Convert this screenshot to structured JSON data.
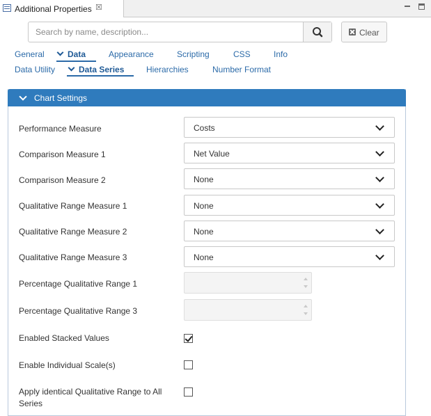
{
  "view": {
    "title": "Additional Properties",
    "close_icon": "close-icon",
    "minimize_icon": "minimize-icon",
    "maximize_icon": "maximize-icon"
  },
  "search": {
    "placeholder": "Search by name, description...",
    "value": "",
    "button_icon": "search-icon",
    "clear_label": "Clear"
  },
  "tabs_row1": [
    {
      "label": "General",
      "active": false
    },
    {
      "label": "Data",
      "active": true
    },
    {
      "label": "Appearance",
      "active": false
    },
    {
      "label": "Scripting",
      "active": false
    },
    {
      "label": "CSS",
      "active": false
    },
    {
      "label": "Info",
      "active": false
    }
  ],
  "tabs_row2": [
    {
      "label": "Data Utility",
      "active": false
    },
    {
      "label": "Data Series",
      "active": true
    },
    {
      "label": "Hierarchies",
      "active": false
    },
    {
      "label": "Number Format",
      "active": false
    }
  ],
  "panel": {
    "title": "Chart Settings",
    "expanded": true
  },
  "fields": {
    "performance_measure": {
      "label": "Performance Measure",
      "value": "Costs"
    },
    "comparison_measure_1": {
      "label": "Comparison Measure 1",
      "value": "Net Value"
    },
    "comparison_measure_2": {
      "label": "Comparison Measure 2",
      "value": "None"
    },
    "qualitative_range_1": {
      "label": "Qualitative Range Measure 1",
      "value": "None"
    },
    "qualitative_range_2": {
      "label": "Qualitative Range Measure 2",
      "value": "None"
    },
    "qualitative_range_3": {
      "label": "Qualitative Range Measure 3",
      "value": "None"
    },
    "percentage_range_1": {
      "label": "Percentage Qualitative Range 1",
      "value": ""
    },
    "percentage_range_3": {
      "label": "Percentage Qualitative Range 3",
      "value": ""
    },
    "enabled_stacked": {
      "label": "Enabled Stacked Values",
      "checked": true
    },
    "individual_scale": {
      "label": "Enable Individual Scale(s)",
      "checked": false
    },
    "identical_range_line1": "Apply identical Qualitative Range to All",
    "identical_range_line2": "Series",
    "identical_range_checked": false
  },
  "colors": {
    "panel_header": "#2f7bbd",
    "link": "#2b6aa8"
  }
}
